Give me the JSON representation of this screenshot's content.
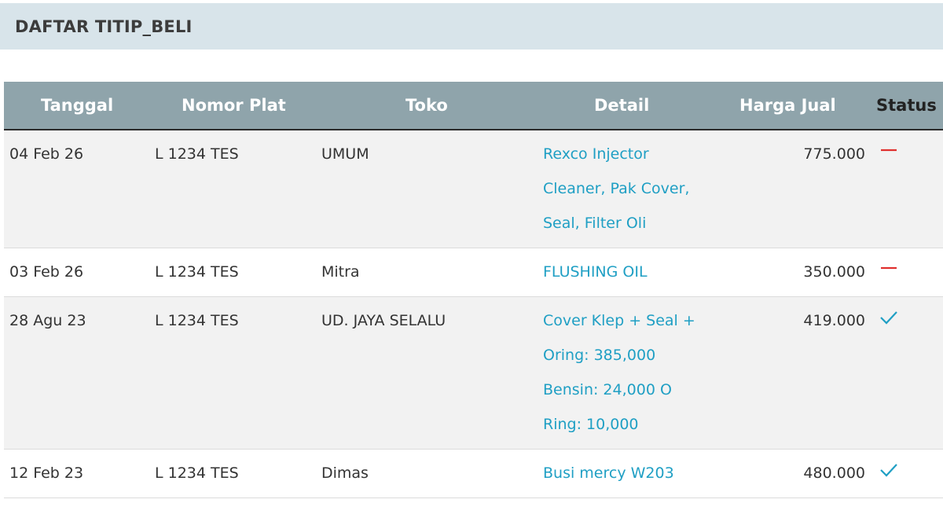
{
  "header": {
    "title": "DAFTAR TITIP_BELI"
  },
  "columns": {
    "tanggal": "Tanggal",
    "nomor_plat": "Nomor Plat",
    "toko": "Toko",
    "detail": "Detail",
    "harga_jual": "Harga Jual",
    "status": "Status"
  },
  "rows": [
    {
      "tanggal": "04 Feb 26",
      "plat": "L 1234 TES",
      "toko": "UMUM",
      "detail": "Rexco Injector Cleaner, Pak Cover, Seal, Filter Oli",
      "harga": "775.000",
      "status": "pending"
    },
    {
      "tanggal": "03 Feb 26",
      "plat": "L 1234 TES",
      "toko": "Mitra",
      "detail": "FLUSHING OIL",
      "harga": "350.000",
      "status": "pending"
    },
    {
      "tanggal": "28 Agu 23",
      "plat": "L 1234 TES",
      "toko": "UD. JAYA SELALU",
      "detail": "Cover Klep + Seal + Oring: 385,000 Bensin: 24,000 O Ring: 10,000",
      "harga": "419.000",
      "status": "done"
    },
    {
      "tanggal": "12 Feb 23",
      "plat": "L 1234 TES",
      "toko": "Dimas",
      "detail": "Busi mercy W203",
      "harga": "480.000",
      "status": "done"
    }
  ],
  "colors": {
    "pending": "#e0302e",
    "done": "#1f9fc4",
    "link": "#1f9fc4"
  },
  "icons": {
    "pending": "minus-icon",
    "done": "check-icon"
  }
}
